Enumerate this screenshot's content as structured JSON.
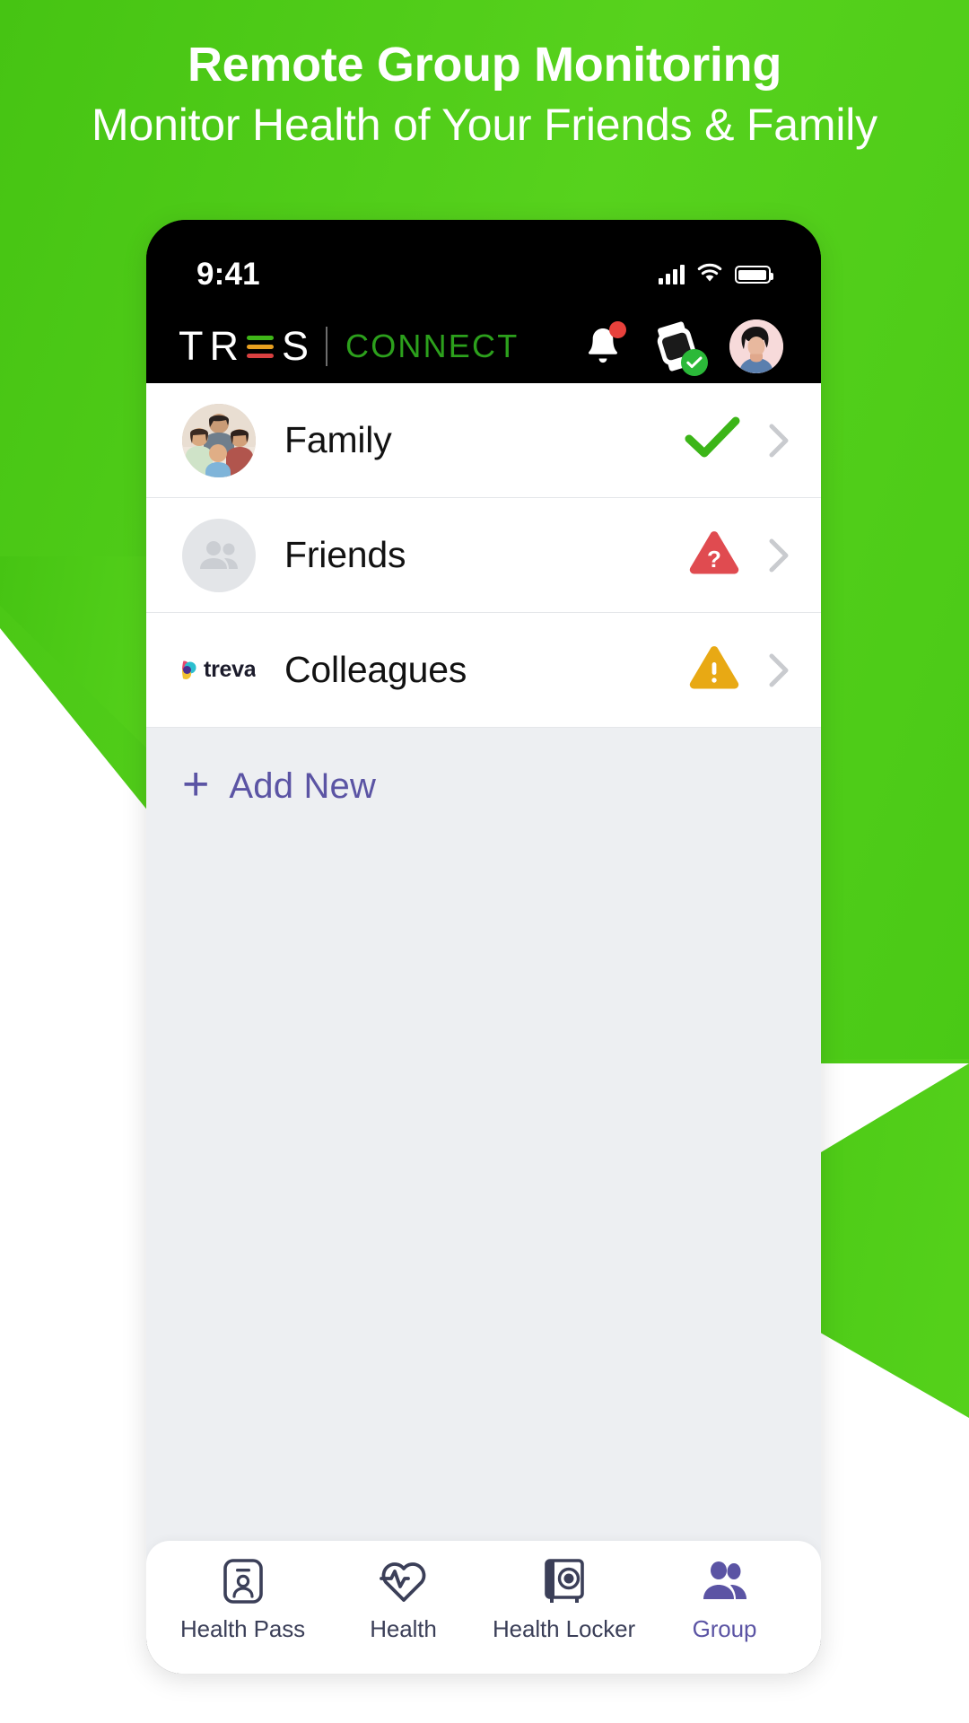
{
  "promo": {
    "headline": "Remote Group Monitoring",
    "subheadline": "Monitor Health of Your Friends & Family",
    "background_color": "#4ECB16"
  },
  "phone": {
    "status_bar": {
      "time": "9:41",
      "signal_icon": "cellular-signal-icon",
      "wifi_icon": "wifi-icon",
      "battery_icon": "battery-icon"
    },
    "app_header": {
      "logo_primary": "TR",
      "logo_primary_tail": "S",
      "logo_e_icon": "tres-e-bars-icon",
      "logo_secondary": "CONNECT",
      "logo_e_colors": [
        "#3FB618",
        "#E8A020",
        "#D94040"
      ],
      "connect_color": "#2CA01C",
      "actions": [
        {
          "name": "notifications-bell-icon",
          "badge": true,
          "badge_color": "#E8413C"
        },
        {
          "name": "smartwatch-icon",
          "badge": true,
          "badge_color": "#2BB939"
        },
        {
          "name": "profile-avatar",
          "badge": false
        }
      ]
    },
    "group_list": {
      "rows": [
        {
          "label": "Family",
          "avatar_icon": "family-photo-avatar",
          "status_icon": "check-mark-icon",
          "status_color": "#3CB518",
          "chevron_icon": "chevron-right-icon"
        },
        {
          "label": "Friends",
          "avatar_icon": "people-placeholder-avatar",
          "status_icon": "question-triangle-icon",
          "status_color": "#E04B50",
          "chevron_icon": "chevron-right-icon"
        },
        {
          "label": "Colleagues",
          "avatar_icon": "treva-logo-avatar",
          "avatar_text": "treva.",
          "status_icon": "warning-triangle-icon",
          "status_color": "#E8A914",
          "chevron_icon": "chevron-right-icon"
        }
      ]
    },
    "add_new": {
      "plus_icon": "plus-icon",
      "label": "Add New",
      "color": "#5B54A4"
    },
    "tab_bar": {
      "tabs": [
        {
          "label": "Health Pass",
          "icon": "health-pass-id-card-icon",
          "active": false
        },
        {
          "label": "Health",
          "icon": "heart-pulse-icon",
          "active": false
        },
        {
          "label": "Health Locker",
          "icon": "safe-vault-icon",
          "active": false
        },
        {
          "label": "Group",
          "icon": "people-group-icon",
          "active": true
        }
      ],
      "active_color": "#5B54A4",
      "inactive_color": "#3B3F58"
    }
  }
}
